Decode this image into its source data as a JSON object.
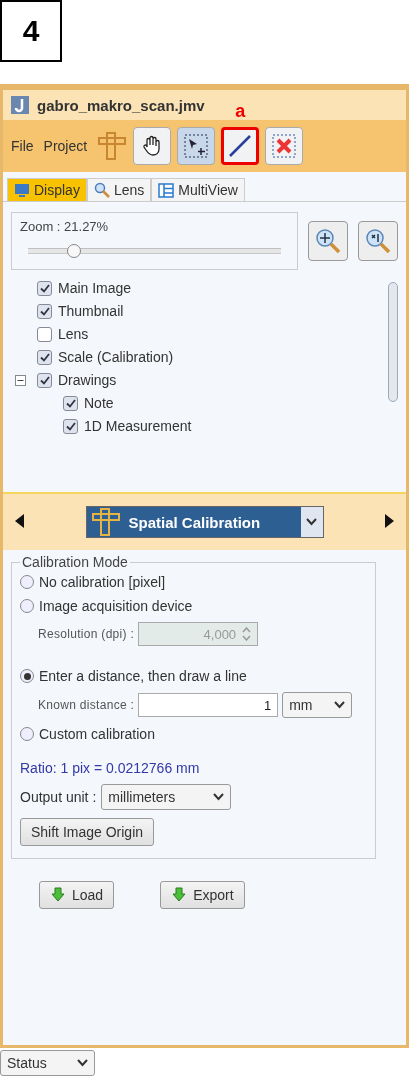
{
  "figure_label": "4",
  "window": {
    "title": "gabro_makro_scan.jmv"
  },
  "menu": [
    "File",
    "Project"
  ],
  "tools": [
    {
      "kind": "hand",
      "selected": false
    },
    {
      "kind": "select",
      "selected": true
    },
    {
      "kind": "line",
      "selected": false,
      "annotation": "a"
    },
    {
      "kind": "delete",
      "selected": false
    }
  ],
  "tabs": [
    {
      "label": "Display",
      "kind": "display",
      "selected": true
    },
    {
      "label": "Lens",
      "kind": "lens",
      "selected": false
    },
    {
      "label": "MultiView",
      "kind": "multiview",
      "selected": false
    }
  ],
  "zoom": {
    "label": "Zoom : 21.27%",
    "level": 0.18
  },
  "layers": [
    {
      "label": "Main Image",
      "checked": true
    },
    {
      "label": "Thumbnail",
      "checked": true
    },
    {
      "label": "Lens",
      "checked": false
    },
    {
      "label": "Scale (Calibration)",
      "checked": true
    },
    {
      "label": "Drawings",
      "checked": true,
      "expanded": true,
      "children": [
        {
          "label": "Note",
          "checked": true
        },
        {
          "label": "1D Measurement",
          "checked": true
        }
      ]
    }
  ],
  "module_selector": {
    "value": "Spatial Calibration"
  },
  "calibration": {
    "title": "Calibration Mode",
    "options": [
      {
        "label": "No calibration [pixel]",
        "selected": false
      },
      {
        "label": "Image acquisition device",
        "selected": false,
        "field": {
          "kind": "spin",
          "label": "Resolution (dpi) :",
          "value": "4,000",
          "disabled": true
        }
      },
      {
        "label": "Enter a distance, then draw a line",
        "selected": true,
        "field": {
          "kind": "distance",
          "label": "Known distance :",
          "value": "1",
          "unit": "mm",
          "disabled": false
        }
      },
      {
        "label": "Custom calibration",
        "selected": false
      }
    ],
    "ratio": "Ratio: 1 pix  = 0.0212766 mm",
    "output_unit": {
      "label": "Output unit :",
      "value": "millimeters"
    },
    "shift_button": "Shift Image Origin"
  },
  "buttons": [
    "Load",
    "Export"
  ],
  "status": "Status"
}
